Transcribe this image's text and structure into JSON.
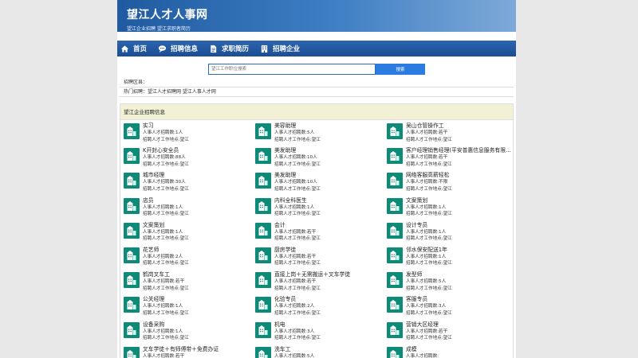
{
  "site": {
    "title": "望江人才人事网",
    "subtitle": "望江企业招聘 望江求职者简历"
  },
  "nav": [
    {
      "label": "首页",
      "icon": "home-icon"
    },
    {
      "label": "招聘信息",
      "icon": "chat-icon"
    },
    {
      "label": "求职简历",
      "icon": "document-icon"
    },
    {
      "label": "招聘企业",
      "icon": "building-icon"
    }
  ],
  "search": {
    "placeholder": "望江工作职位搜索",
    "button": "搜索"
  },
  "region_label": "招聘区县：",
  "hot_label": "热门招聘：望江人才招聘网 望江人事人才网",
  "panel_title": "望江企业招聘信息",
  "colors": {
    "accent": "#1f5aa0",
    "icon_bg": "#0e8a78",
    "panel_head": "#f3f1d5"
  },
  "jobs": [
    {
      "title": "实习",
      "count": "人事人才招聘数:1人",
      "place": "招聘人才工作地点:望江"
    },
    {
      "title": "美容助理",
      "count": "人事人才招聘数:5人",
      "place": "招聘人才工作地点:望江"
    },
    {
      "title": "吴山仓管操作工",
      "count": "人事人才招聘数:若干",
      "place": "招聘人才工作地点:望江"
    },
    {
      "title": "K开封心安全员",
      "count": "人事人才招聘数:88人",
      "place": "招聘人才工作地点:望江"
    },
    {
      "title": "美发助理",
      "count": "人事人才招聘数:10人",
      "place": "招聘人才工作地点:望江"
    },
    {
      "title": "客户经理销售经理(平安普惠信息服务有限公司)",
      "count": "人事人才招聘数:若干",
      "place": "招聘人才工作地点:望江"
    },
    {
      "title": "城市经理",
      "count": "人事人才招聘数:30人",
      "place": "招聘人才工作地点:望江"
    },
    {
      "title": "美发助理",
      "count": "人事人才招聘数:10人",
      "place": "招聘人才工作地点:望江"
    },
    {
      "title": "网络客服高薪轻松",
      "count": "人事人才招聘数:不限",
      "place": "招聘人才工作地点:望江"
    },
    {
      "title": "店员",
      "count": "人事人才招聘数:1人",
      "place": "招聘人才工作地点:望江"
    },
    {
      "title": "内科全科医生",
      "count": "人事人才招聘数:1人",
      "place": "招聘人才工作地点:望江"
    },
    {
      "title": "文案策划",
      "count": "人事人才招聘数:1人",
      "place": "招聘人才工作地点:望江"
    },
    {
      "title": "文案策划",
      "count": "人事人才招聘数:1人",
      "place": "招聘人才工作地点:望江"
    },
    {
      "title": "会计",
      "count": "人事人才招聘数:若干",
      "place": "招聘人才工作地点:望江"
    },
    {
      "title": "设计专员",
      "count": "人事人才招聘数:1人",
      "place": "招聘人才工作地点:望江"
    },
    {
      "title": "花艺师",
      "count": "人事人才招聘数:2人",
      "place": "招聘人才工作地点:望江"
    },
    {
      "title": "厨房学徒",
      "count": "人事人才招聘数:若干",
      "place": "招聘人才工作地点:望江"
    },
    {
      "title": "邻水保安配送1年",
      "count": "人事人才招聘数:1人",
      "place": "招聘人才工作地点:望江"
    },
    {
      "title": "鹤岗叉车工",
      "count": "人事人才招聘数:若干",
      "place": "招聘人才工作地点:望江"
    },
    {
      "title": "直接上岗＋无需搬运＋叉车学徒",
      "count": "人事人才招聘数:若干",
      "place": "招聘人才工作地点:望江"
    },
    {
      "title": "发型师",
      "count": "人事人才招聘数:5人",
      "place": "招聘人才工作地点:望江"
    },
    {
      "title": "公关经理",
      "count": "人事人才招聘数:1人",
      "place": "招聘人才工作地点:望江"
    },
    {
      "title": "化验专员",
      "count": "人事人才招聘数:2人",
      "place": "招聘人才工作地点:望江"
    },
    {
      "title": "客服专员",
      "count": "人事人才招聘数:3人",
      "place": "招聘人才工作地点:望江"
    },
    {
      "title": "设备采购",
      "count": "人事人才招聘数:1人",
      "place": "招聘人才工作地点:望江"
    },
    {
      "title": "机电",
      "count": "人事人才招聘数:3人",
      "place": "招聘人才工作地点:望江"
    },
    {
      "title": "营销大区经理",
      "count": "人事人才招聘数:若干",
      "place": "招聘人才工作地点:望江"
    },
    {
      "title": "叉车学徒＋有师傅带＋免费办证",
      "count": "人事人才招聘数:若干",
      "place": "招聘人才工作地点:望江"
    },
    {
      "title": "洗车工",
      "count": "人事人才招聘数:5人",
      "place": "招聘人才工作地点:望江"
    },
    {
      "title": "成模",
      "count": "人事人才招聘数:",
      "place": "招聘人才工作地点:望江"
    }
  ]
}
